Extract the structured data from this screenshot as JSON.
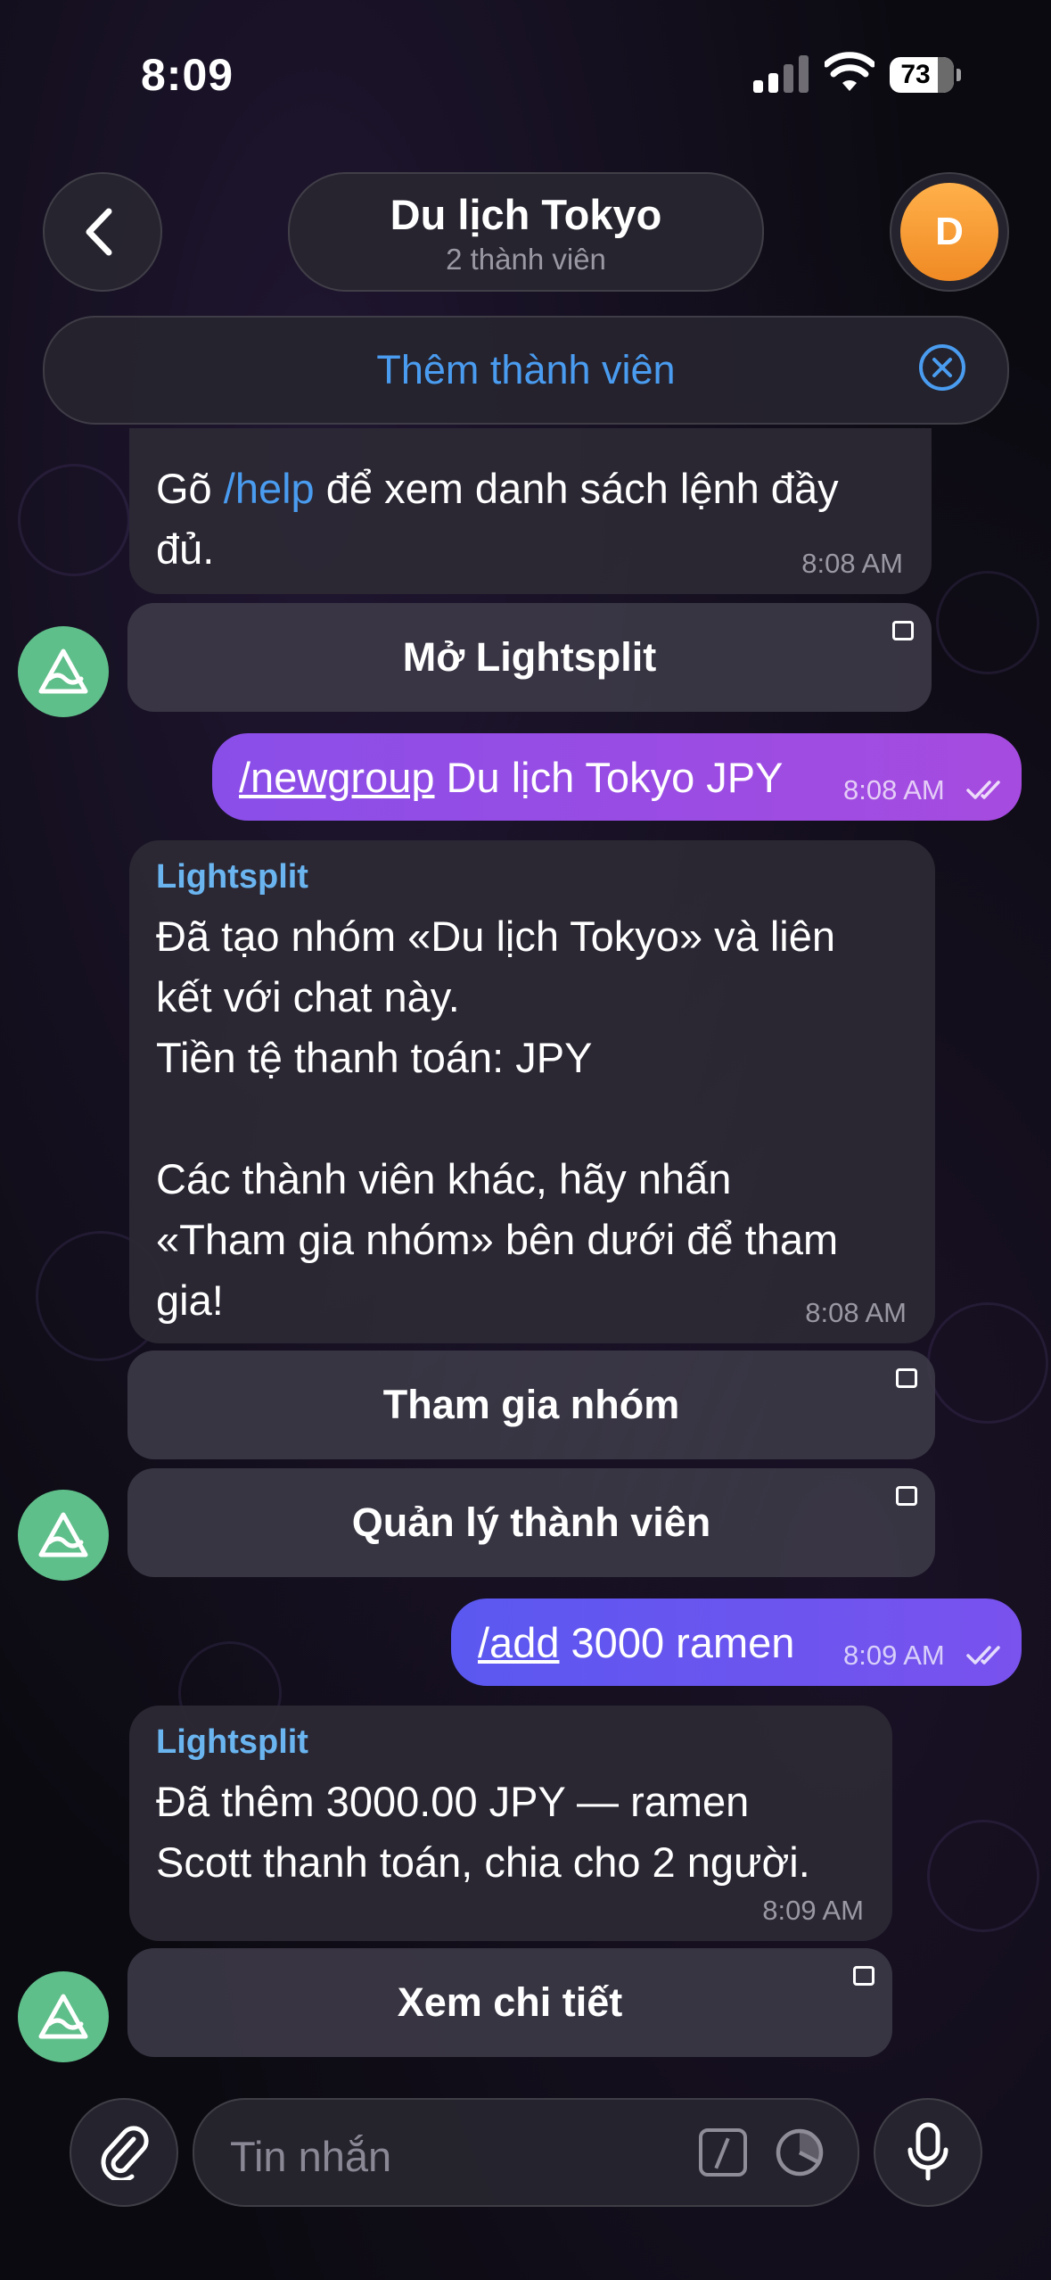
{
  "status_bar": {
    "time": "8:09",
    "battery": "73"
  },
  "header": {
    "back_icon": "chevron-left-icon",
    "title": "Du lịch Tokyo",
    "subtitle": "2 thành viên",
    "avatar_letter": "D",
    "avatar_color": "#f59a30"
  },
  "add_member_banner": {
    "label": "Thêm thành viên",
    "close_icon": "close-circle-icon"
  },
  "messages": [
    {
      "type": "bot",
      "text_before": "Gõ ",
      "link": "/help",
      "text_after": " để xem danh sách lệnh đầy đủ.",
      "time": "8:08 AM",
      "button": "Mở Lightsplit"
    },
    {
      "type": "outgoing",
      "command": "/newgroup",
      "text": " Du lịch Tokyo JPY",
      "time": "8:08 AM",
      "status": "read"
    },
    {
      "type": "bot",
      "sender": "Lightsplit",
      "lines": [
        "Đã tạo nhóm «Du lịch Tokyo» và liên",
        "kết với chat này.",
        "Tiền tệ thanh toán: JPY",
        "",
        "Các thành viên khác, hãy nhấn",
        "«Tham gia nhóm» bên dưới để tham",
        "gia!"
      ],
      "time": "8:08 AM",
      "buttons": [
        "Tham gia nhóm",
        "Quản lý thành viên"
      ]
    },
    {
      "type": "outgoing",
      "command": "/add",
      "text": " 3000 ramen",
      "time": "8:09 AM",
      "status": "read"
    },
    {
      "type": "bot",
      "sender": "Lightsplit",
      "lines": [
        "Đã thêm 3000.00 JPY — ramen",
        "Scott thanh toán, chia cho 2 người."
      ],
      "time": "8:09 AM",
      "button": "Xem chi tiết"
    }
  ],
  "input_bar": {
    "placeholder": "Tin nhắn",
    "attach_icon": "paperclip-icon",
    "commands_icon": "slash-command-icon",
    "timer_icon": "timer-icon",
    "mic_icon": "microphone-icon"
  },
  "colors": {
    "accent_blue": "#4a9cf0",
    "sender_blue": "#6ab4f0",
    "outgoing_purple": "#9a4de6",
    "outgoing_indigo": "#6655f0",
    "bot_avatar_green": "#5fbf8a"
  }
}
